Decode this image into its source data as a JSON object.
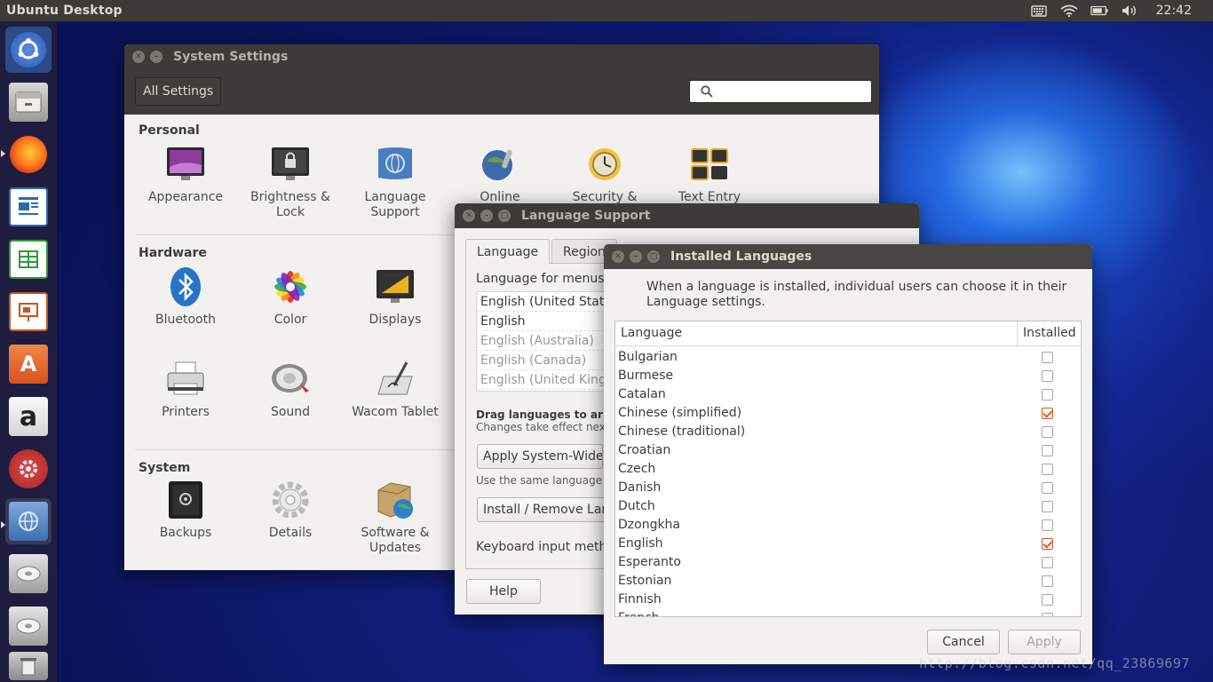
{
  "top_panel": {
    "title": "Ubuntu Desktop",
    "clock": "22:42",
    "indicators": [
      "keyboard-icon",
      "wifi-icon",
      "battery-icon",
      "volume-icon"
    ]
  },
  "launcher": {
    "items": [
      {
        "name": "ubuntu-dash-icon",
        "color": "#3a6cc7"
      },
      {
        "name": "files-icon",
        "color": "#7d7a73"
      },
      {
        "name": "firefox-icon",
        "color": "#e66000"
      },
      {
        "name": "libreoffice-writer-icon",
        "color": "#2a6ab3"
      },
      {
        "name": "libreoffice-calc-icon",
        "color": "#2f9a3a"
      },
      {
        "name": "libreoffice-impress-icon",
        "color": "#c9531f"
      },
      {
        "name": "software-center-icon",
        "color": "#e0642a"
      },
      {
        "name": "amazon-icon",
        "color": "#d9d9d9"
      },
      {
        "name": "system-settings-icon",
        "color": "#c62f2f"
      },
      {
        "name": "language-support-icon",
        "color": "#4b7fbd"
      },
      {
        "name": "disk-drive-icon",
        "color": "#9a9a9a"
      },
      {
        "name": "disk-drive-icon-2",
        "color": "#9a9a9a"
      },
      {
        "name": "trash-icon",
        "color": "#6b6b6b"
      }
    ]
  },
  "system_settings": {
    "window_title": "System Settings",
    "all_settings_label": "All Settings",
    "sections": {
      "personal": "Personal",
      "hardware": "Hardware",
      "system": "System"
    },
    "personal_items": [
      {
        "label": "Appearance",
        "icon": "appearance-icon"
      },
      {
        "label": "Brightness & Lock",
        "icon": "brightness-lock-icon"
      },
      {
        "label": "Language Support",
        "icon": "language-support-icon"
      },
      {
        "label": "Online",
        "icon": "online-accounts-icon"
      },
      {
        "label": "Security &",
        "icon": "security-privacy-icon"
      },
      {
        "label": "Text Entry",
        "icon": "text-entry-icon"
      }
    ],
    "hardware_items": [
      {
        "label": "Bluetooth",
        "icon": "bluetooth-icon"
      },
      {
        "label": "Color",
        "icon": "color-icon"
      },
      {
        "label": "Displays",
        "icon": "displays-icon"
      },
      {
        "label": "Printers",
        "icon": "printers-icon"
      },
      {
        "label": "Sound",
        "icon": "sound-icon"
      },
      {
        "label": "Wacom Tablet",
        "icon": "wacom-tablet-icon"
      }
    ],
    "system_items": [
      {
        "label": "Backups",
        "icon": "backups-icon"
      },
      {
        "label": "Details",
        "icon": "details-icon"
      },
      {
        "label": "Software & Updates",
        "icon": "software-updates-icon"
      }
    ]
  },
  "language_support": {
    "window_title": "Language Support",
    "tabs": [
      "Language",
      "Region"
    ],
    "menus_label": "Language for menus",
    "languages": [
      {
        "label": "English (United State",
        "dim": false
      },
      {
        "label": "English",
        "dim": false
      },
      {
        "label": "English (Australia)",
        "dim": true
      },
      {
        "label": "English (Canada)",
        "dim": true
      },
      {
        "label": "English (United King",
        "dim": true
      }
    ],
    "drag_hint": "Drag languages to arrang",
    "changes_hint": "Changes take effect next t",
    "apply_system_wide": "Apply System-Wide",
    "same_language_hint": "Use the same language cho",
    "install_remove": "Install / Remove Lan",
    "keyboard_input": "Keyboard input meth",
    "help": "Help"
  },
  "installed_languages": {
    "window_title": "Installed Languages",
    "description": "When a language is installed, individual users can choose it in their Language settings.",
    "col_language": "Language",
    "col_installed": "Installed",
    "rows": [
      {
        "name": "Bulgarian",
        "installed": false
      },
      {
        "name": "Burmese",
        "installed": false
      },
      {
        "name": "Catalan",
        "installed": false
      },
      {
        "name": "Chinese (simplified)",
        "installed": true
      },
      {
        "name": "Chinese (traditional)",
        "installed": false
      },
      {
        "name": "Croatian",
        "installed": false
      },
      {
        "name": "Czech",
        "installed": false
      },
      {
        "name": "Danish",
        "installed": false
      },
      {
        "name": "Dutch",
        "installed": false
      },
      {
        "name": "Dzongkha",
        "installed": false
      },
      {
        "name": "English",
        "installed": true
      },
      {
        "name": "Esperanto",
        "installed": false
      },
      {
        "name": "Estonian",
        "installed": false
      },
      {
        "name": "Finnish",
        "installed": false
      },
      {
        "name": "French",
        "installed": false
      }
    ],
    "cancel": "Cancel",
    "apply": "Apply"
  },
  "watermark": "http://blog.csdn.net/qq_23869697",
  "colors": {
    "panel": "#3c3b37",
    "accent_orange": "#e05e1f",
    "window_bg": "#f2f1f0"
  }
}
